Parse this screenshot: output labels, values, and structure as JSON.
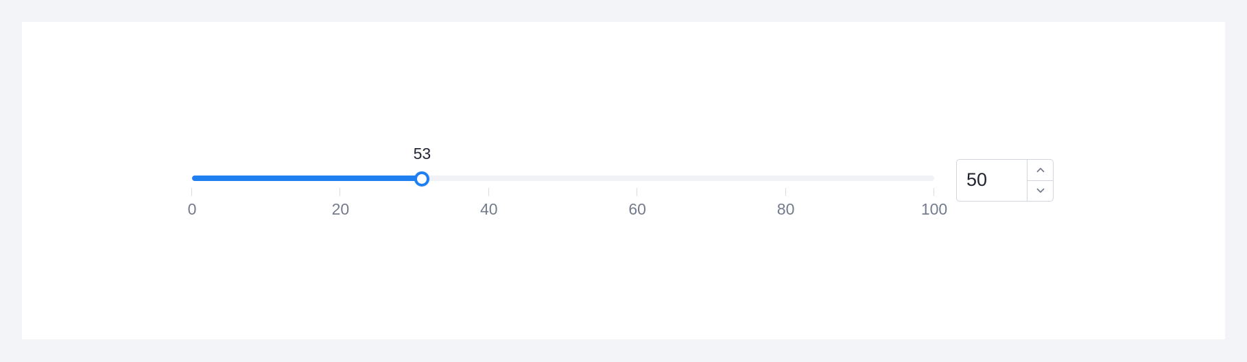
{
  "slider": {
    "min": 0,
    "max": 100,
    "value": 31,
    "tooltip": "53",
    "marks": [
      "0",
      "20",
      "40",
      "60",
      "80",
      "100"
    ],
    "accent_color": "#1f7ef0",
    "track_color": "#f1f2f5"
  },
  "number_input": {
    "value": "50",
    "up_icon": "chevron-up-icon",
    "down_icon": "chevron-down-icon"
  }
}
